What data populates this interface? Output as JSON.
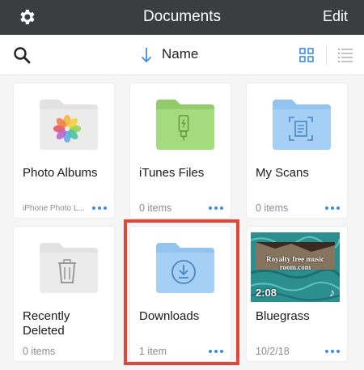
{
  "header": {
    "title": "Documents",
    "edit_label": "Edit",
    "settings_icon": "gear-icon"
  },
  "toolbar": {
    "search_icon": "search-icon",
    "sort_icon": "arrow-down-icon",
    "sort_label": "Name",
    "grid_view_icon": "grid-icon",
    "list_view_icon": "list-icon",
    "active_view": "grid"
  },
  "items": [
    {
      "name": "Photo Albums",
      "subtitle": "iPhone Photo L...",
      "icon": "photos-icon",
      "folder_color": "#e6e6e6"
    },
    {
      "name": "iTunes Files",
      "subtitle": "0 items",
      "icon": "usb-cable-icon",
      "folder_color": "#a5db7f"
    },
    {
      "name": "My Scans",
      "subtitle": "0 items",
      "icon": "scan-document-icon",
      "folder_color": "#a6cff5"
    },
    {
      "name": "Recently Deleted",
      "subtitle": "0 items",
      "icon": "trash-icon",
      "folder_color": "#e6e6e6"
    },
    {
      "name": "Downloads",
      "subtitle": "1 item",
      "icon": "download-icon",
      "folder_color": "#a6cff5",
      "highlighted": true
    },
    {
      "name": "Bluegrass",
      "subtitle": "10/2/18",
      "icon": "video-thumbnail",
      "duration": "2:08",
      "thumbnail_caption": "Royalty free music room.com"
    }
  ],
  "colors": {
    "nav_bar": "#3b3d3f",
    "accent": "#3d8de0",
    "highlight_border": "#e0463a"
  }
}
